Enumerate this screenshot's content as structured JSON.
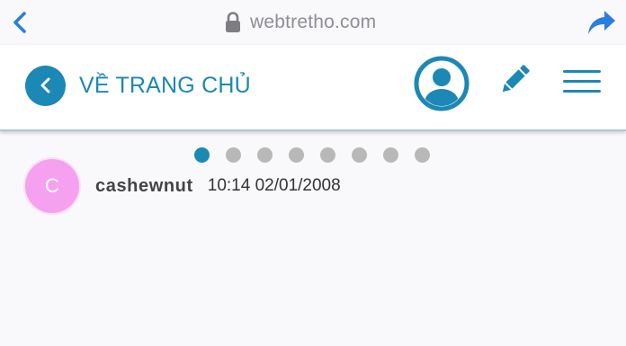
{
  "browser": {
    "url": "webtretho.com"
  },
  "header": {
    "home_label": "VỀ TRANG CHỦ"
  },
  "pager": {
    "total_pages": 8,
    "current_page": 1
  },
  "post": {
    "author_initial": "C",
    "author_name": "cashewnut",
    "timestamp": "10:14 02/01/2008"
  },
  "colors": {
    "brand_blue": "#1b88b5",
    "ios_blue": "#2a7ee0",
    "avatar_pink": "#f5a1ef",
    "dot_inactive": "#b8b8b8"
  },
  "icons": {
    "browser_back": "chevron-left-icon",
    "lock": "lock-icon",
    "share": "share-arrow-icon",
    "home_back": "chevron-left-icon",
    "user": "user-avatar-icon",
    "edit": "pencil-icon",
    "menu": "hamburger-menu-icon"
  }
}
